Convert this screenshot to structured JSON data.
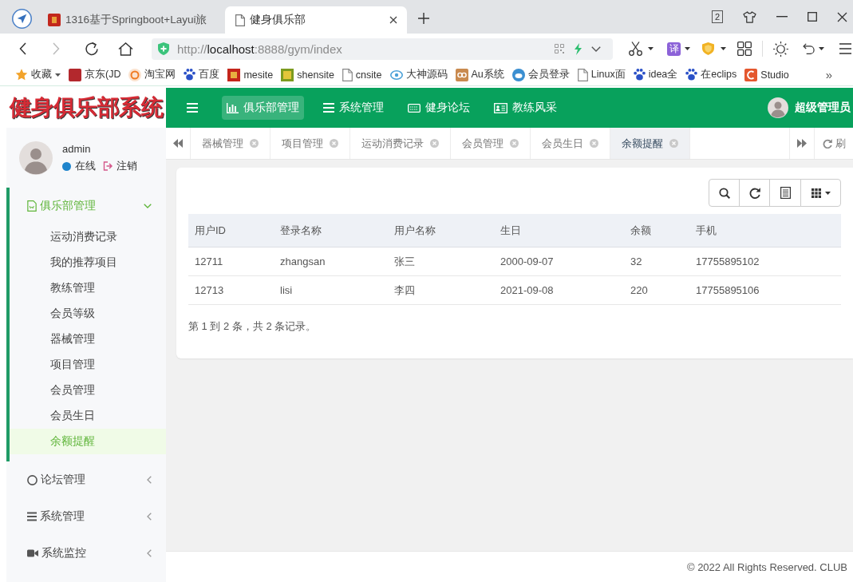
{
  "browser": {
    "tabs": [
      {
        "title": "1316基于Springboot+Layui旅",
        "selected": false
      },
      {
        "title": "健身俱乐部",
        "selected": true
      }
    ],
    "tab_count": "2",
    "address": "http://**localhost**:8888/gym/index",
    "translate": "译",
    "bookmarks": [
      {
        "label": "收藏",
        "kind": "menu"
      },
      {
        "label": "京东(JD",
        "kind": "link"
      },
      {
        "label": "淘宝网",
        "kind": "link"
      },
      {
        "label": "百度",
        "kind": "link"
      },
      {
        "label": "mesite",
        "kind": "link"
      },
      {
        "label": "shensite",
        "kind": "link"
      },
      {
        "label": "cnsite",
        "kind": "link"
      },
      {
        "label": "大神源码",
        "kind": "link"
      },
      {
        "label": "Au系统",
        "kind": "link"
      },
      {
        "label": "会员登录",
        "kind": "link"
      },
      {
        "label": "Linux面",
        "kind": "link"
      },
      {
        "label": "idea全",
        "kind": "link"
      },
      {
        "label": "在eclips",
        "kind": "link"
      },
      {
        "label": "Studio",
        "kind": "link"
      }
    ],
    "bookmarks_more": "»"
  },
  "header": {
    "logo": "健身俱乐部系统",
    "nav": [
      {
        "label": "俱乐部管理",
        "selected": true
      },
      {
        "label": "系统管理",
        "selected": false
      },
      {
        "label": "健身论坛",
        "selected": false
      },
      {
        "label": "教练风采",
        "selected": false
      }
    ],
    "user": "超级管理员"
  },
  "sidebar": {
    "user": {
      "name": "admin",
      "status": "在线",
      "logout": "注销"
    },
    "menu": [
      {
        "label": "俱乐部管理",
        "selected": true,
        "expanded": true,
        "children": [
          {
            "label": "运动消费记录",
            "selected": false
          },
          {
            "label": "我的推荐项目",
            "selected": false
          },
          {
            "label": "教练管理",
            "selected": false
          },
          {
            "label": "会员等级",
            "selected": false
          },
          {
            "label": "器械管理",
            "selected": false
          },
          {
            "label": "项目管理",
            "selected": false
          },
          {
            "label": "会员管理",
            "selected": false
          },
          {
            "label": "会员生日",
            "selected": false
          },
          {
            "label": "余额提醒",
            "selected": true
          }
        ]
      },
      {
        "label": "论坛管理",
        "selected": false,
        "expanded": false
      },
      {
        "label": "系统管理",
        "selected": false,
        "expanded": false
      },
      {
        "label": "系统监控",
        "selected": false,
        "expanded": false
      }
    ]
  },
  "page_tabs": {
    "tabs": [
      {
        "label": "器械管理",
        "selected": false
      },
      {
        "label": "项目管理",
        "selected": false
      },
      {
        "label": "运动消费记录",
        "selected": false
      },
      {
        "label": "会员管理",
        "selected": false
      },
      {
        "label": "会员生日",
        "selected": false
      },
      {
        "label": "余额提醒",
        "selected": true
      }
    ],
    "refresh": "刷"
  },
  "table": {
    "columns": [
      "用户ID",
      "登录名称",
      "用户名称",
      "生日",
      "余额",
      "手机"
    ],
    "rows": [
      [
        "12711",
        "zhangsan",
        "张三",
        "2000-09-07",
        "32",
        "17755895102"
      ],
      [
        "12713",
        "lisi",
        "李四",
        "2021-09-08",
        "220",
        "17755895106"
      ]
    ]
  },
  "pagination": "第 1 到 2 条，共 2 条记录。",
  "footer": "© 2022 All Rights Reserved. CLUB"
}
